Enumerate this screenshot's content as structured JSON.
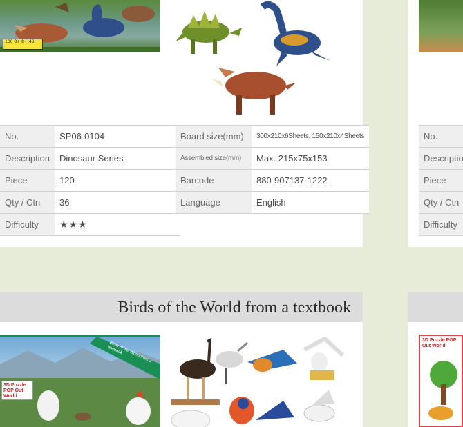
{
  "top_product": {
    "badge_text": "100 8+ 8+ 46",
    "specs_left": [
      {
        "label": "No.",
        "value": "SP06-0104"
      },
      {
        "label": "Description",
        "value": "Dinosaur Series"
      },
      {
        "label": "Piece",
        "value": "120"
      },
      {
        "label": "Qty / Ctn",
        "value": "36"
      },
      {
        "label": "Difficulty",
        "value": "★★★"
      }
    ],
    "specs_right": [
      {
        "label": "Board size(mm)",
        "value": "300x210x6Sheets, 150x210x4Sheets"
      },
      {
        "label": "Assembled size(mm)",
        "value": "Max. 215x75x153"
      },
      {
        "label": "Barcode",
        "value": "880-907137-1222"
      },
      {
        "label": "Language",
        "value": "English"
      }
    ]
  },
  "right_product_partial": {
    "labels": [
      "No.",
      "Description",
      "Piece",
      "Qty / Ctn",
      "Difficulty"
    ]
  },
  "bottom_product": {
    "title": "Birds of the World from a textbook",
    "box_brand": "3D Puzzle POP Out World",
    "box_ribbon": "Birds of the World from a textbook",
    "right_box_brand": "3D Puzzle POP Out World"
  },
  "colors": {
    "page_bg": "#e6ecd8",
    "card_bg": "#ffffff",
    "label_bg": "#efefef",
    "title_bar_bg": "#dcdcdc",
    "ribbon_green": "#1a8f55"
  }
}
